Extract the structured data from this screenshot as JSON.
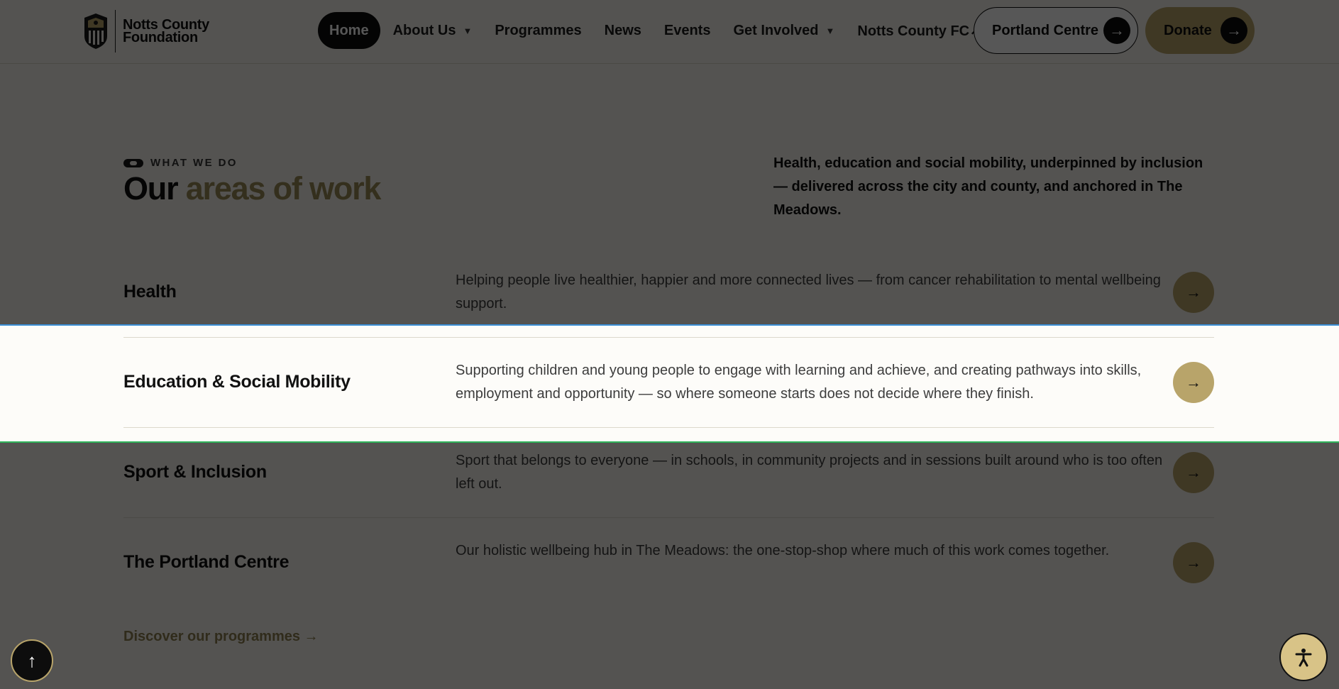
{
  "header": {
    "logo_line1": "Notts County",
    "logo_line2": "Foundation",
    "nav": [
      {
        "label": "Home"
      },
      {
        "label": "About Us"
      },
      {
        "label": "Programmes"
      },
      {
        "label": "News"
      },
      {
        "label": "Events"
      },
      {
        "label": "Get Involved"
      },
      {
        "label": "Notts County FC↗"
      }
    ],
    "caret": "▼",
    "portland_label": "Portland Centre",
    "donate_label": "Donate",
    "arrow": "→"
  },
  "section": {
    "eyebrow": "WHAT WE DO",
    "title_plain": "Our",
    "title_accent": "areas of work",
    "intro": "Health, education and social mobility, underpinned by inclusion — delivered across the city and county, and anchored in The Meadows."
  },
  "areas": [
    {
      "title": "Health",
      "desc": "Helping people live healthier, happier and more connected lives — from cancer rehabilitation to mental wellbeing support.",
      "arrow": "→"
    },
    {
      "title": "Education & Social Mobility",
      "desc": "Supporting children and young people to engage with learning and achieve, and creating pathways into skills, employment and opportunity — so where someone starts does not decide where they finish.",
      "arrow": "→"
    },
    {
      "title": "Sport & Inclusion",
      "desc": "Sport that belongs to everyone — in schools, in community projects and in sessions built around who is too often left out.",
      "arrow": "→"
    },
    {
      "title": "The Portland Centre",
      "desc": "Our holistic wellbeing hub in The Meadows: the one-stop-shop where much of this work comes together.",
      "arrow": "→"
    }
  ],
  "discover_link": "Discover our programmes →",
  "floating": {
    "scroll_top_glyph": "↑"
  },
  "colors": {
    "accent_gold": "#b8a46a",
    "dark": "#0d0d0d",
    "background": "#f6f4ee",
    "focus_top_line": "#3b8fd6",
    "focus_bottom_line": "#2fb45a"
  }
}
